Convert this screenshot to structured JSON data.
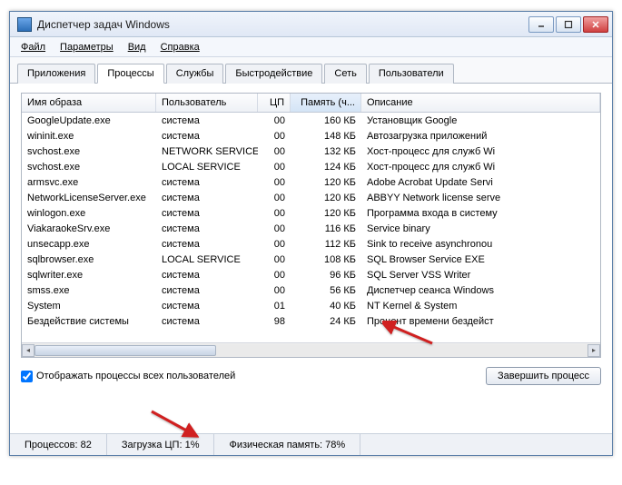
{
  "window": {
    "title": "Диспетчер задач Windows"
  },
  "menu": {
    "file": "Файл",
    "options": "Параметры",
    "view": "Вид",
    "help": "Справка"
  },
  "tabs": {
    "apps": "Приложения",
    "processes": "Процессы",
    "services": "Службы",
    "performance": "Быстродействие",
    "network": "Сеть",
    "users": "Пользователи"
  },
  "columns": {
    "image": "Имя образа",
    "user": "Пользователь",
    "cpu": "ЦП",
    "mem": "Память (ч...",
    "desc": "Описание"
  },
  "rows": [
    {
      "image": "GoogleUpdate.exe",
      "user": "система",
      "cpu": "00",
      "mem": "160 КБ",
      "desc": "Установщик Google"
    },
    {
      "image": "wininit.exe",
      "user": "система",
      "cpu": "00",
      "mem": "148 КБ",
      "desc": "Автозагрузка приложений"
    },
    {
      "image": "svchost.exe",
      "user": "NETWORK SERVICE",
      "cpu": "00",
      "mem": "132 КБ",
      "desc": "Хост-процесс для служб Wi"
    },
    {
      "image": "svchost.exe",
      "user": "LOCAL SERVICE",
      "cpu": "00",
      "mem": "124 КБ",
      "desc": "Хост-процесс для служб Wi"
    },
    {
      "image": "armsvc.exe",
      "user": "система",
      "cpu": "00",
      "mem": "120 КБ",
      "desc": "Adobe Acrobat Update Servi"
    },
    {
      "image": "NetworkLicenseServer.exe",
      "user": "система",
      "cpu": "00",
      "mem": "120 КБ",
      "desc": "ABBYY Network license serve"
    },
    {
      "image": "winlogon.exe",
      "user": "система",
      "cpu": "00",
      "mem": "120 КБ",
      "desc": "Программа входа в систему"
    },
    {
      "image": "ViakaraokeSrv.exe",
      "user": "система",
      "cpu": "00",
      "mem": "116 КБ",
      "desc": "Service binary"
    },
    {
      "image": "unsecapp.exe",
      "user": "система",
      "cpu": "00",
      "mem": "112 КБ",
      "desc": "Sink to receive asynchronou"
    },
    {
      "image": "sqlbrowser.exe",
      "user": "LOCAL SERVICE",
      "cpu": "00",
      "mem": "108 КБ",
      "desc": "SQL Browser Service EXE"
    },
    {
      "image": "sqlwriter.exe",
      "user": "система",
      "cpu": "00",
      "mem": "96 КБ",
      "desc": "SQL Server VSS Writer"
    },
    {
      "image": "smss.exe",
      "user": "система",
      "cpu": "00",
      "mem": "56 КБ",
      "desc": "Диспетчер сеанса Windows"
    },
    {
      "image": "System",
      "user": "система",
      "cpu": "01",
      "mem": "40 КБ",
      "desc": "NT Kernel & System"
    },
    {
      "image": "Бездействие системы",
      "user": "система",
      "cpu": "98",
      "mem": "24 КБ",
      "desc": "Процент времени бездейст"
    }
  ],
  "checkbox": {
    "label": "Отображать процессы всех пользователей"
  },
  "endprocess": "Завершить процесс",
  "status": {
    "processes": "Процессов: 82",
    "cpu": "Загрузка ЦП: 1%",
    "mem": "Физическая память: 78%"
  }
}
